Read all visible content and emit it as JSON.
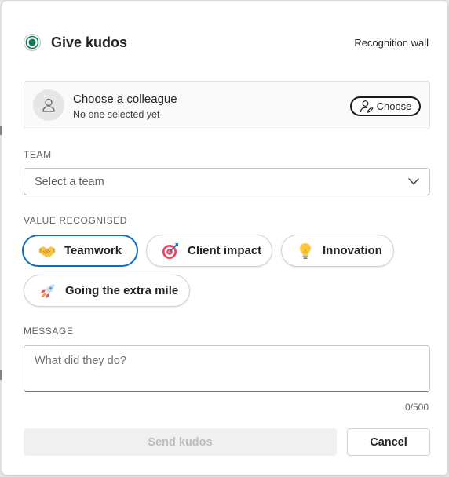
{
  "header": {
    "title": "Give kudos",
    "recognition_wall_link": "Recognition wall",
    "title_icon": "radio-target-icon"
  },
  "colleague": {
    "title": "Choose a colleague",
    "subtitle": "No one selected yet",
    "choose_button": "Choose",
    "avatar_icon": "person-icon",
    "choose_icon": "person-edit-icon"
  },
  "team": {
    "label": "TEAM",
    "placeholder": "Select a team",
    "dropdown_icon": "chevron-down-icon"
  },
  "values": {
    "label": "VALUE RECOGNISED",
    "selected": "Teamwork",
    "options": [
      {
        "label": "Teamwork",
        "icon": "handshake-icon"
      },
      {
        "label": "Client impact",
        "icon": "target-icon"
      },
      {
        "label": "Innovation",
        "icon": "lightbulb-icon"
      },
      {
        "label": "Going the extra mile",
        "icon": "rocket-icon"
      }
    ]
  },
  "message": {
    "label": "MESSAGE",
    "placeholder": "What did they do?",
    "value": "",
    "counter": "0/500"
  },
  "actions": {
    "send_label": "Send kudos",
    "cancel_label": "Cancel"
  },
  "colors": {
    "accent": "#0f6cbd",
    "title_icon": "#0e7a5a",
    "disabled_bg": "#f0f0f0",
    "disabled_text": "#bdbdbd"
  }
}
